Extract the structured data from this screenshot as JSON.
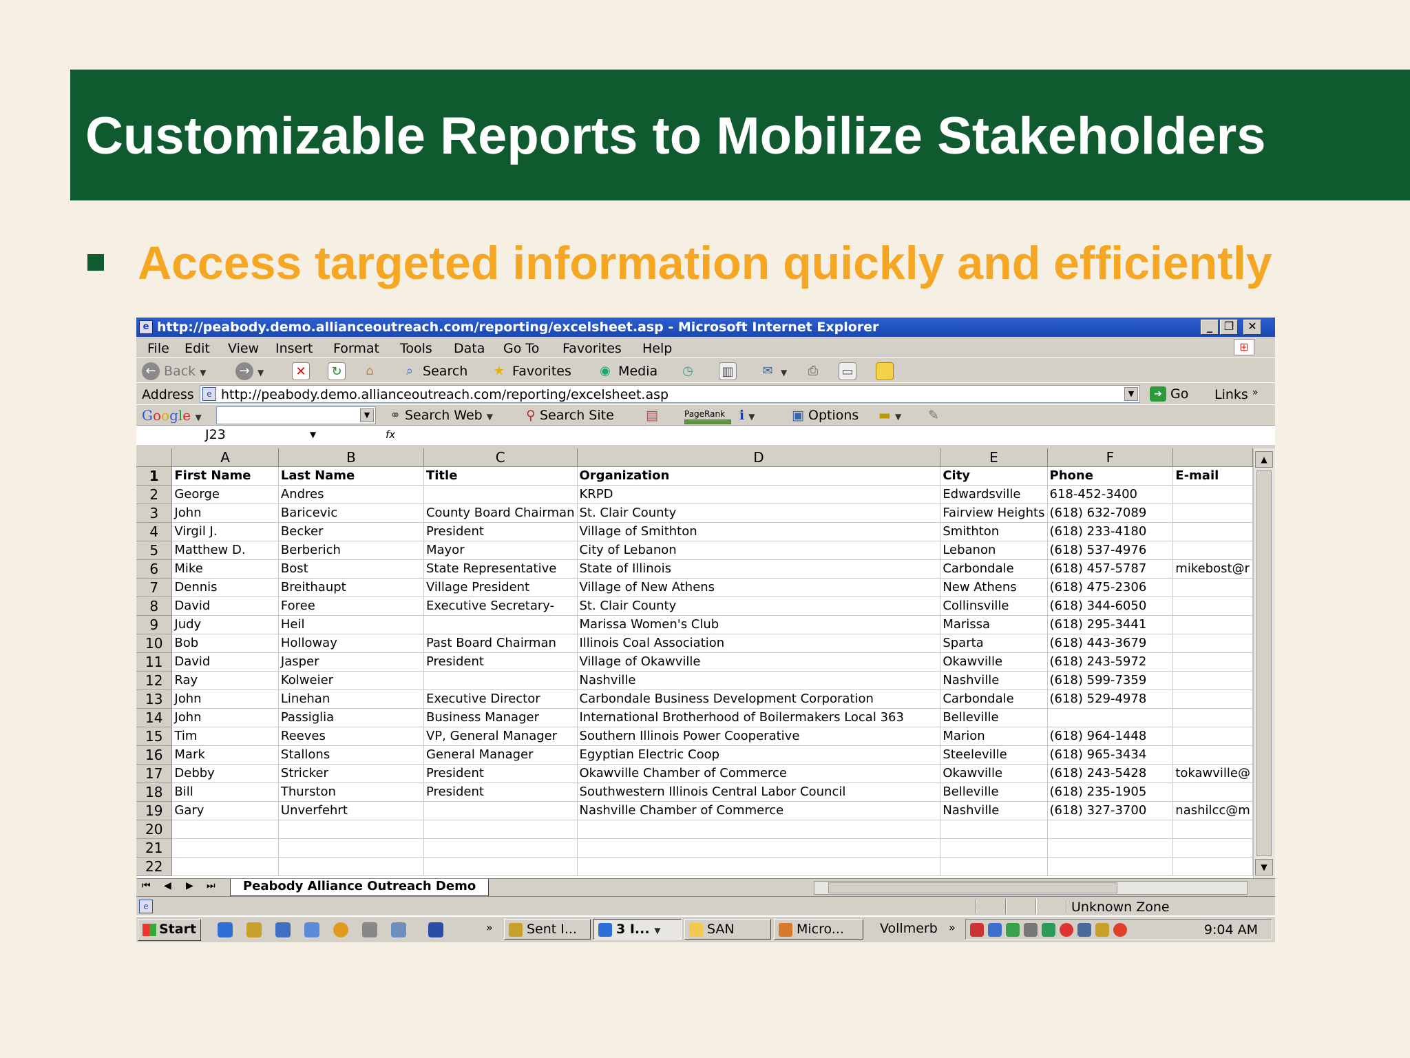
{
  "slide": {
    "title": "Customizable Reports to Mobilize Stakeholders",
    "bullet": "Access targeted information quickly and efficiently",
    "title_bg": "#0f5a2f",
    "bullet_color": "#f5a623",
    "page_bg": "#f5efe4"
  },
  "browser": {
    "window_title": "http://peabody.demo.allianceoutreach.com/reporting/excelsheet.asp - Microsoft Internet Explorer",
    "menu": [
      "File",
      "Edit",
      "View",
      "Insert",
      "Format",
      "Tools",
      "Data",
      "Go To",
      "Favorites",
      "Help"
    ],
    "toolbar": {
      "back": "Back",
      "search": "Search",
      "favorites": "Favorites",
      "media": "Media"
    },
    "address_label": "Address",
    "address_url": "http://peabody.demo.allianceoutreach.com/reporting/excelsheet.asp",
    "go": "Go",
    "links": "Links",
    "links_chevron": "»",
    "google": {
      "logo": "Google",
      "search_web": "Search Web",
      "search_site": "Search Site",
      "pagerank": "PageRank",
      "options": "Options"
    }
  },
  "sheet": {
    "name_box": "J23",
    "fx": "fx",
    "col_letters": [
      "A",
      "B",
      "C",
      "D",
      "E",
      "F",
      ""
    ],
    "headers": [
      "First Name",
      "Last Name",
      "Title",
      "Organization",
      "City",
      "Phone",
      "E-mail"
    ],
    "rows": [
      [
        "George",
        "Andres",
        "",
        "KRPD",
        "Edwardsville",
        "618-452-3400",
        ""
      ],
      [
        "John",
        "Baricevic",
        "County Board Chairman",
        "St. Clair County",
        "Fairview Heights",
        "(618) 632-7089",
        ""
      ],
      [
        "Virgil J.",
        "Becker",
        "President",
        "Village of Smithton",
        "Smithton",
        "(618) 233-4180",
        ""
      ],
      [
        "Matthew D.",
        "Berberich",
        "Mayor",
        "City of Lebanon",
        "Lebanon",
        "(618) 537-4976",
        ""
      ],
      [
        "Mike",
        "Bost",
        "State Representative",
        "State of Illinois",
        "Carbondale",
        "(618) 457-5787",
        "mikebost@r"
      ],
      [
        "Dennis",
        "Breithaupt",
        "Village President",
        "Village of New Athens",
        "New Athens",
        "(618) 475-2306",
        ""
      ],
      [
        "David",
        "Foree",
        "Executive Secretary-",
        "St. Clair County",
        "Collinsville",
        "(618) 344-6050",
        ""
      ],
      [
        "Judy",
        "Heil",
        "",
        "Marissa Women's Club",
        "Marissa",
        "(618) 295-3441",
        ""
      ],
      [
        "Bob",
        "Holloway",
        "Past Board Chairman",
        "Illinois Coal Association",
        "Sparta",
        "(618) 443-3679",
        ""
      ],
      [
        "David",
        "Jasper",
        "President",
        "Village of Okawville",
        "Okawville",
        "(618) 243-5972",
        ""
      ],
      [
        "Ray",
        "Kolweier",
        "",
        "Nashville",
        "Nashville",
        "(618) 599-7359",
        ""
      ],
      [
        "John",
        "Linehan",
        "Executive Director",
        "Carbondale Business Development Corporation",
        "Carbondale",
        "(618) 529-4978",
        ""
      ],
      [
        "John",
        "Passiglia",
        "Business Manager",
        "International Brotherhood of Boilermakers Local 363",
        "Belleville",
        "",
        ""
      ],
      [
        "Tim",
        "Reeves",
        "VP, General Manager",
        "Southern Illinois Power Cooperative",
        "Marion",
        "(618) 964-1448",
        ""
      ],
      [
        "Mark",
        "Stallons",
        "General Manager",
        "Egyptian Electric Coop",
        "Steeleville",
        "(618) 965-3434",
        ""
      ],
      [
        "Debby",
        "Stricker",
        "President",
        "Okawville Chamber of Commerce",
        "Okawville",
        "(618) 243-5428",
        "tokawville@"
      ],
      [
        "Bill",
        "Thurston",
        "President",
        "Southwestern Illinois Central Labor Council",
        "Belleville",
        "(618) 235-1905",
        ""
      ],
      [
        "Gary",
        "Unverfehrt",
        "",
        "Nashville Chamber of Commerce",
        "Nashville",
        "(618) 327-3700",
        "nashilcc@m"
      ],
      [
        "",
        "",
        "",
        "",
        "",
        "",
        ""
      ],
      [
        "",
        "",
        "",
        "",
        "",
        "",
        ""
      ],
      [
        "",
        "",
        "",
        "",
        "",
        "",
        ""
      ]
    ],
    "row_numbers": [
      "1",
      "2",
      "3",
      "4",
      "5",
      "6",
      "7",
      "8",
      "9",
      "10",
      "11",
      "12",
      "13",
      "14",
      "15",
      "16",
      "17",
      "18",
      "19",
      "20",
      "21",
      "22"
    ],
    "tab_name": "Peabody Alliance Outreach Demo"
  },
  "status": {
    "zone": "Unknown Zone"
  },
  "taskbar": {
    "start": "Start",
    "chevron": "»",
    "tasks": [
      "Sent I...",
      "3 I...",
      "SAN",
      "Micro...",
      "Vollmerb"
    ],
    "clock": "9:04 AM"
  }
}
